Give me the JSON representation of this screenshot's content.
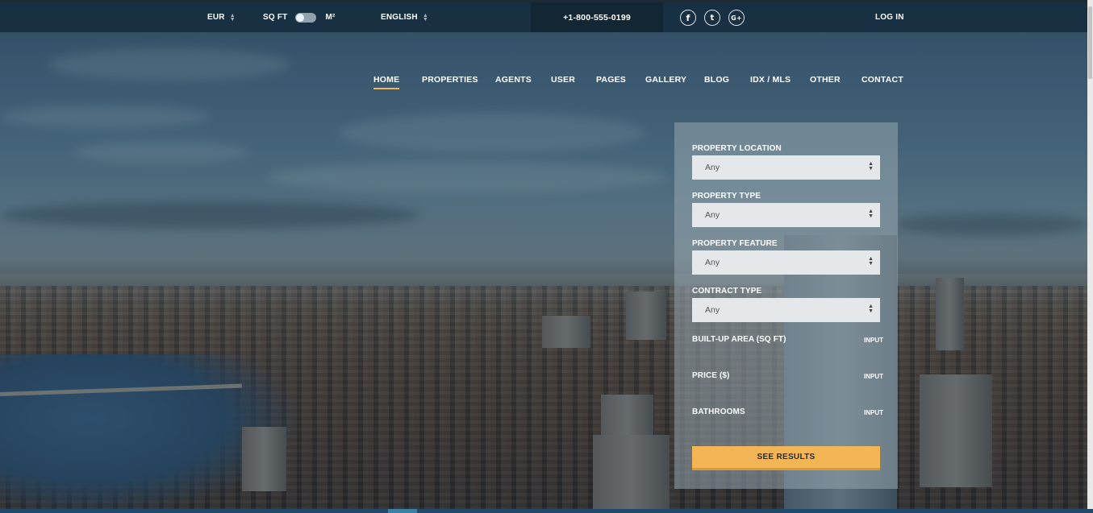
{
  "topbar": {
    "currency": "EUR",
    "unit_left": "SQ FT",
    "unit_right": "M²",
    "language": "ENGLISH",
    "phone": "+1-800-555-0199",
    "social": {
      "facebook": "f",
      "twitter": "t",
      "google": "G+"
    },
    "login": "LOG IN"
  },
  "nav": {
    "items": [
      "HOME",
      "PROPERTIES",
      "AGENTS",
      "USER",
      "PAGES",
      "GALLERY",
      "BLOG",
      "IDX / MLS",
      "OTHER",
      "CONTACT"
    ],
    "active": "HOME"
  },
  "search": {
    "fields": [
      {
        "label": "PROPERTY LOCATION",
        "value": "Any"
      },
      {
        "label": "PROPERTY TYPE",
        "value": "Any"
      },
      {
        "label": "PROPERTY FEATURE",
        "value": "Any"
      },
      {
        "label": "CONTRACT TYPE",
        "value": "Any"
      }
    ],
    "ranges": [
      {
        "label": "BUILT-UP AREA (SQ FT)",
        "tag": "INPUT"
      },
      {
        "label": "PRICE ($)",
        "tag": "INPUT"
      },
      {
        "label": "BATHROOMS",
        "tag": "INPUT"
      }
    ],
    "submit": "SEE RESULTS"
  },
  "colors": {
    "accent": "#f2b657",
    "topbar": "#122a3a",
    "phone_block": "#132634"
  },
  "icons": [
    "chevron-updown-icon",
    "toggle-switch",
    "facebook-icon",
    "twitter-icon",
    "google-plus-icon"
  ]
}
